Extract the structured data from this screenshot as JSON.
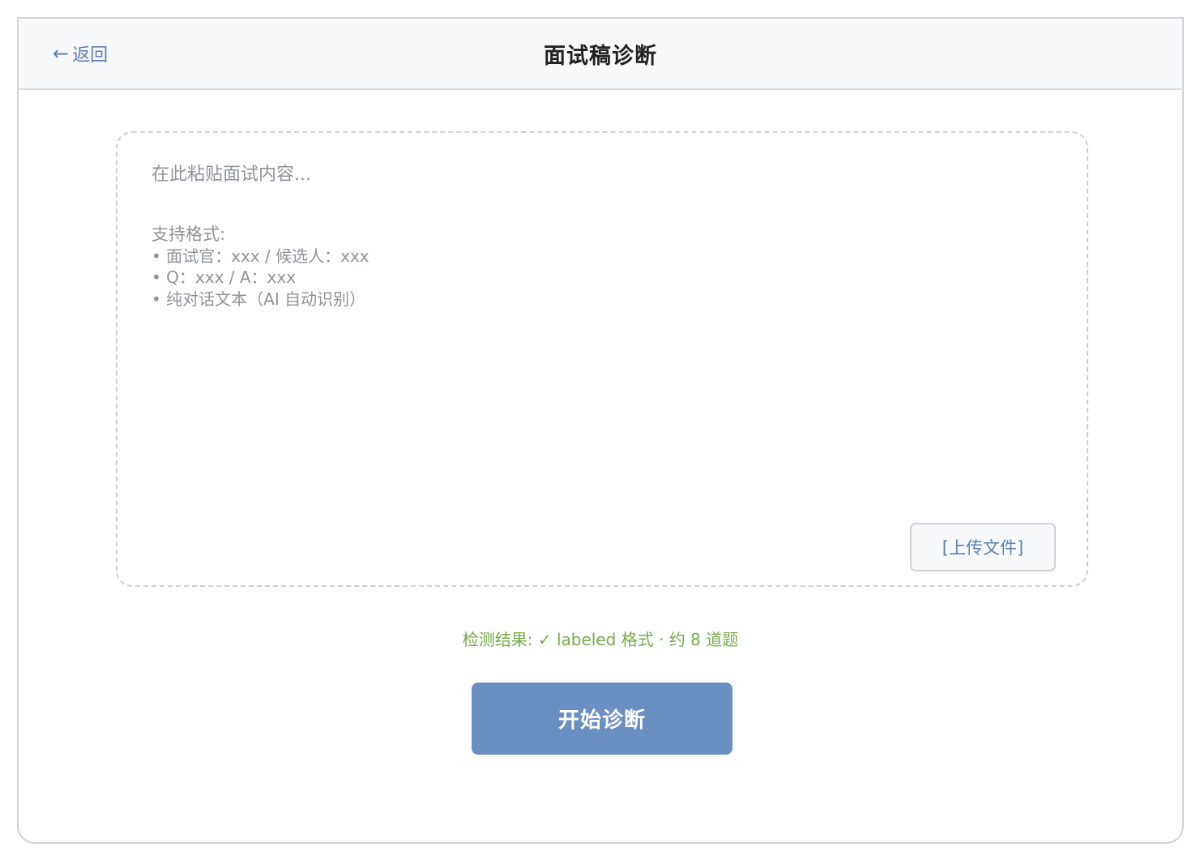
{
  "header": {
    "back_arrow": "←",
    "back_label": "返回",
    "title": "面试稿诊断"
  },
  "paste_area": {
    "placeholder": "在此粘贴面试内容...",
    "formats_title": "支持格式:",
    "format_items": [
      "• 面试官：xxx / 候选人：xxx",
      "• Q：xxx / A：xxx",
      "• 纯对话文本（AI 自动识别）"
    ],
    "upload_label": "[上传文件]"
  },
  "detection": {
    "result_text": "检测结果: ✓ labeled 格式 · 约 8 道题"
  },
  "actions": {
    "start_label": "开始诊断"
  },
  "colors": {
    "accent": "#6a8fc2",
    "link": "#5e82b5",
    "success": "#74ac48"
  }
}
